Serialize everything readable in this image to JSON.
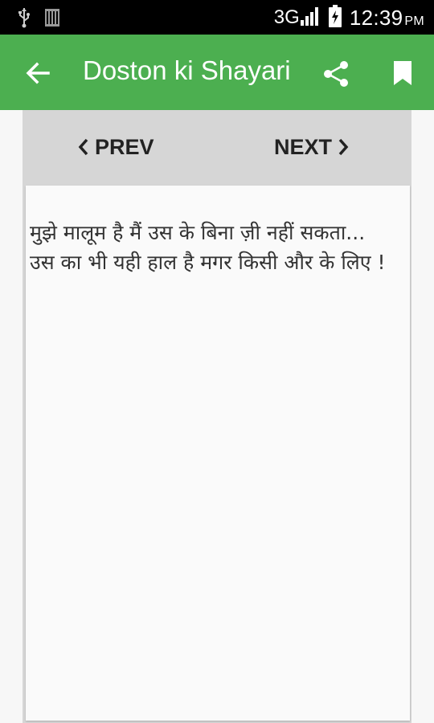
{
  "status_bar": {
    "network": "3G",
    "time": "12:39",
    "ampm": "PM"
  },
  "app_bar": {
    "title": "Doston ki Shayari",
    "accent_color": "#4caf50"
  },
  "navigation": {
    "prev_label": "PREV",
    "next_label": "NEXT"
  },
  "content": {
    "text": "मुझे मालूम है मैं उस के बिना ज़ी नहीं सकता...\nउस का भी यही हाल है मगर किसी और के लिए !"
  },
  "icons": {
    "usb": "usb-icon",
    "signal": "signal-icon",
    "battery": "battery-charging-icon",
    "back": "arrow-back-icon",
    "share": "share-icon",
    "bookmark": "bookmark-icon",
    "prev": "chevron-left-icon",
    "next": "chevron-right-icon"
  }
}
